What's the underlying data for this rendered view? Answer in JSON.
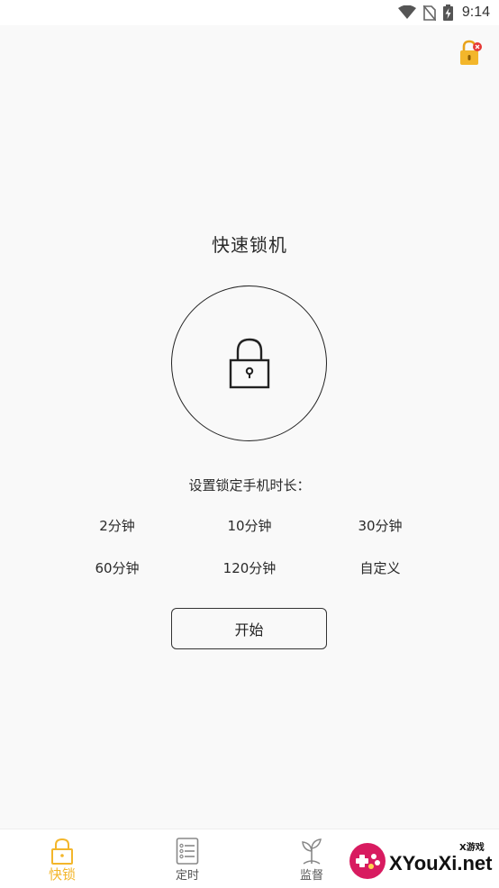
{
  "status_bar": {
    "time": "9:14",
    "icons": [
      "wifi-icon",
      "no-sim-icon",
      "battery-charging-icon"
    ]
  },
  "header": {
    "lock_status_icon": "lock-unlocked-icon"
  },
  "main": {
    "title": "快速锁机",
    "lock_icon": "padlock-icon",
    "duration_label": "设置锁定手机时长：",
    "options": [
      "2分钟",
      "10分钟",
      "30分钟",
      "60分钟",
      "120分钟",
      "自定义"
    ],
    "start_label": "开始"
  },
  "bottom_nav": {
    "items": [
      {
        "label": "快锁",
        "icon": "padlock-icon",
        "active": true
      },
      {
        "label": "定时",
        "icon": "list-icon",
        "active": false
      },
      {
        "label": "监督",
        "icon": "sprout-icon",
        "active": false
      }
    ]
  },
  "colors": {
    "accent": "#f3b62b",
    "background": "#f9f9f9"
  },
  "watermark": {
    "text": "XYouXi.net",
    "small_text": "X游戏"
  }
}
